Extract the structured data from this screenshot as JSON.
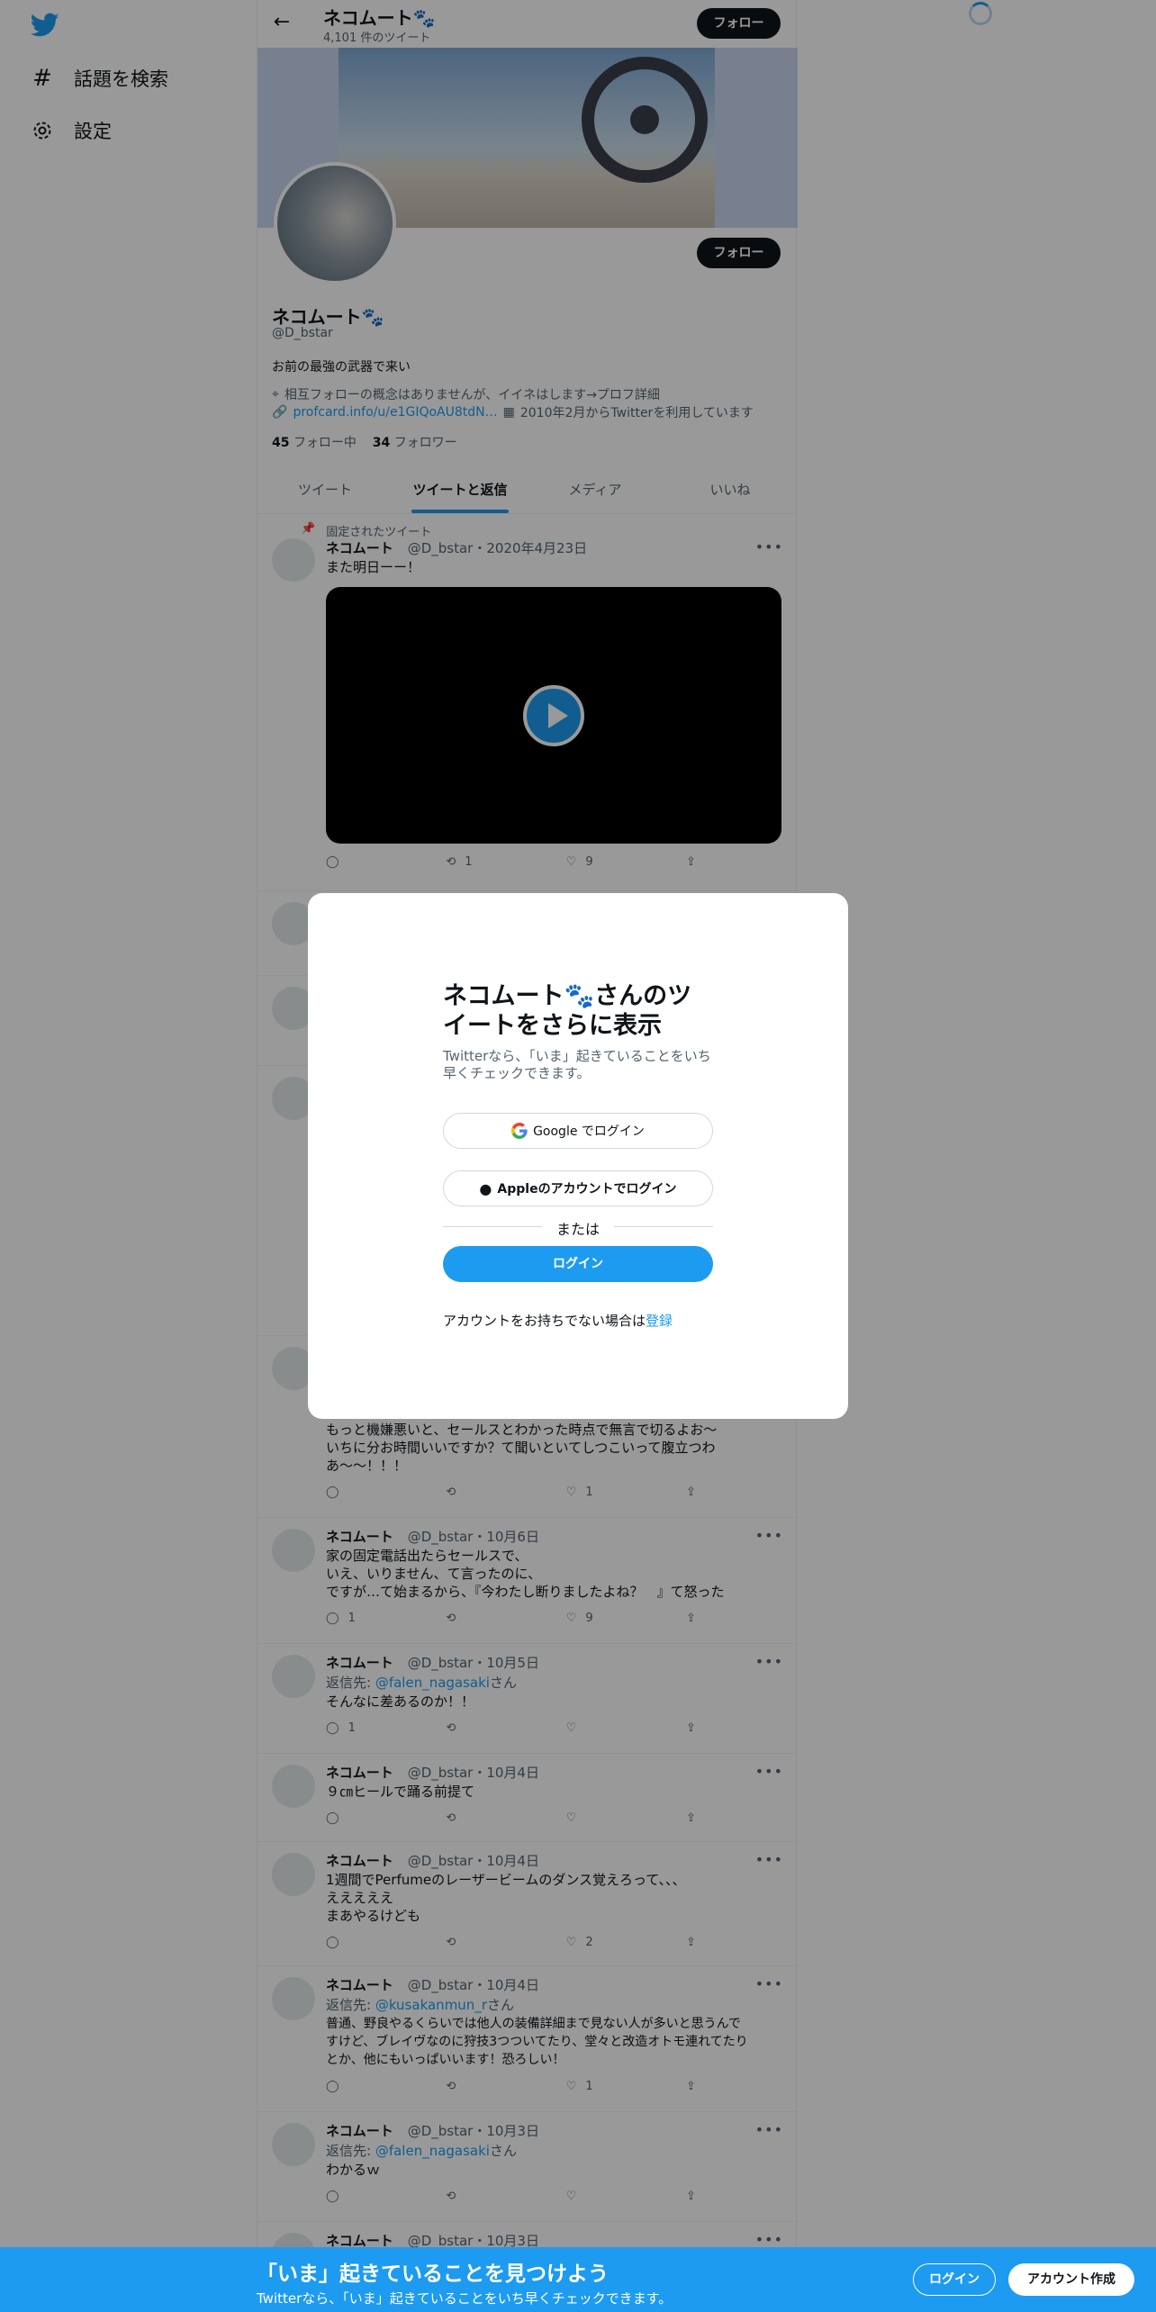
{
  "sidebar": {
    "items": [
      {
        "label": "話題を検索",
        "icon": "hashtag-icon"
      },
      {
        "label": "設定",
        "icon": "gear-icon"
      }
    ]
  },
  "header": {
    "name": "ネコムート🐾",
    "tweet_count": "4,101 件のツイート",
    "follow_label": "フォロー"
  },
  "profile": {
    "name": "ネコムート🐾",
    "handle": "@D_bstar",
    "follow_label": "フォロー",
    "bio": "お前の最強の武器で来い",
    "location": "相互フォローの概念はありませんが、イイネはします→プロフ詳細",
    "url": "profcard.info/u/e1GIQoAU8tdN…",
    "joined": "2010年2月からTwitterを利用しています",
    "following_count": "45",
    "following_label": "フォロー中",
    "followers_count": "34",
    "followers_label": "フォロワー"
  },
  "tabs": [
    "ツイート",
    "ツイートと返信",
    "メディア",
    "いいね"
  ],
  "pinned": {
    "label": "固定されたツイート",
    "name": "ネコムート",
    "meta": "@D_bstar・2020年4月23日",
    "text": "また明日ーー！",
    "retweets": "1",
    "likes": "9"
  },
  "tweets": [
    {
      "name": "",
      "meta": "",
      "text": "もっと機嫌悪いと、セールスとわかった時点で無言で切るよお〜\nいちに分お時間いいですか？て聞いといてしつこいって腹立つわ\nあ〜〜！！！",
      "replies": "",
      "retweets": "",
      "likes": "1"
    },
    {
      "name": "ネコムート",
      "meta": "@D_bstar・10月6日",
      "text": "家の固定電話出たらセールスで、\nいえ、いりません、て言ったのに、\nですが…て始まるから、『今わたし断りましたよね？　』て怒った",
      "replies": "1",
      "retweets": "",
      "likes": "9"
    },
    {
      "name": "ネコムート",
      "meta": "@D_bstar・10月5日",
      "reply_prefix": "返信先: ",
      "reply_to": "@falen_nagasaki",
      "reply_suffix": "さん",
      "text": "そんなに差あるのか！！",
      "replies": "1",
      "retweets": "",
      "likes": ""
    },
    {
      "name": "ネコムート",
      "meta": "@D_bstar・10月4日",
      "text": "９㎝ヒールで踊る前提て",
      "replies": "",
      "retweets": "",
      "likes": ""
    },
    {
      "name": "ネコムート",
      "meta": "@D_bstar・10月4日",
      "text": "1週間でPerfumeのレーザービームのダンス覚えろって、、、\nえええええ\nまあやるけども",
      "replies": "",
      "retweets": "",
      "likes": "2"
    },
    {
      "name": "ネコムート",
      "meta": "@D_bstar・10月4日",
      "reply_prefix": "返信先: ",
      "reply_to": "@kusakanmun_r",
      "reply_suffix": "さん",
      "text": "普通、野良やるくらいでは他人の装備詳細まで見ない人が多いと思うんで\nすけど、ブレイヴなのに狩技3つついてたり、堂々と改造オトモ連れてたり\nとか、他にもいっぱいいます！恐ろしい！",
      "replies": "",
      "retweets": "",
      "likes": "1"
    },
    {
      "name": "ネコムート",
      "meta": "@D_bstar・10月3日",
      "reply_prefix": "返信先: ",
      "reply_to": "@falen_nagasaki",
      "reply_suffix": "さん",
      "text": "わかるｗ",
      "replies": "",
      "retweets": "",
      "likes": ""
    },
    {
      "name": "ネコムート",
      "meta": "@D_bstar・10月3日",
      "text": "",
      "replies": "",
      "retweets": "",
      "likes": ""
    }
  ],
  "modal": {
    "title_line1": "ネコムート🐾さんのツ",
    "title_line2": "イートをさらに表示",
    "subtitle": "Twitterなら、「いま」起きていることをいち早くチェックできます。",
    "google_label": "Google でログイン",
    "apple_label": "Appleのアカウントでログイン",
    "or_label": "または",
    "login_label": "ログイン",
    "no_account_text": "アカウントをお持ちでない場合は",
    "signup_link": "登録"
  },
  "bottom_bar": {
    "title": "「いま」起きていることを見つけよう",
    "subtitle": "Twitterなら、「いま」起きていることをいち早くチェックできます。",
    "login_label": "ログイン",
    "signup_label": "アカウント作成"
  },
  "colors": {
    "accent": "#1d9bf0",
    "text": "#0f1419",
    "secondary": "#536471"
  }
}
